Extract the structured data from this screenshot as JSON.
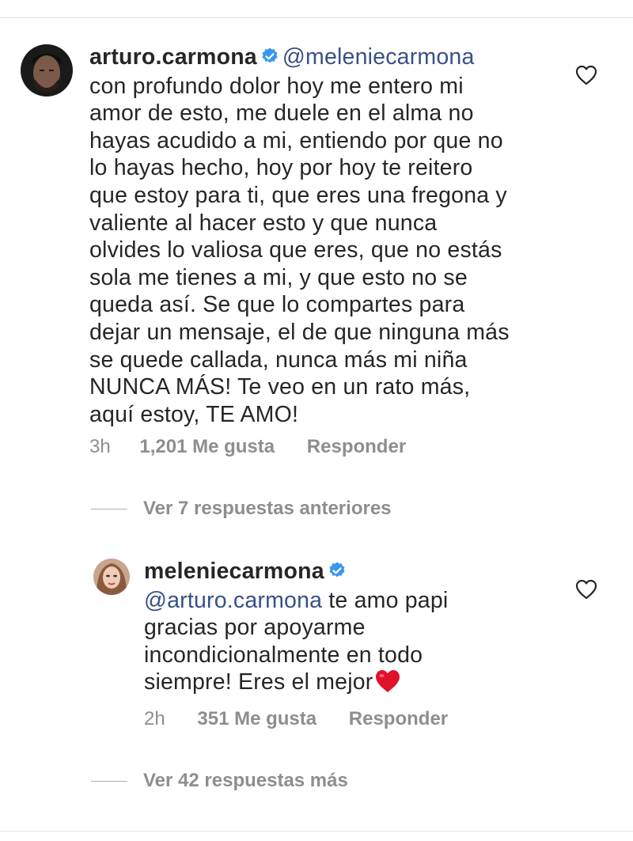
{
  "comments": {
    "main": {
      "username": "arturo.carmona",
      "mention": "@meleniecarmona",
      "lines": [
        "con profundo dolor hoy me entero mi",
        "amor de esto, me duele en el alma no",
        "hayas acudido a mi, entiendo por que no",
        "lo hayas hecho, hoy por hoy te reitero",
        "que estoy para ti, que eres una fregona y",
        "valiente al hacer esto y que nunca",
        "olvides lo valiosa que eres, que no estás",
        "sola me tienes a mi, y que esto no se",
        "queda así. Se que lo compartes para",
        "dejar un mensaje, el de que ninguna más",
        "se quede callada, nunca más mi niña",
        "NUNCA MÁS! Te veo en un rato más,",
        "aquí estoy, TE AMO!"
      ],
      "time": "3h",
      "likes": "1,201 Me gusta",
      "reply": "Responder"
    },
    "view_previous": "Ver 7 respuestas anteriores",
    "reply": {
      "username": "meleniecarmona",
      "mention": "@arturo.carmona",
      "first_line_rest": " te amo papi",
      "lines": [
        "gracias por apoyarme",
        "incondicionalmente en todo"
      ],
      "last_line": "siempre! Eres el mejor",
      "emoji": "red-heart-emoji",
      "time": "2h",
      "likes": "351 Me gusta",
      "reply": "Responder"
    },
    "view_more": "Ver 42 respuestas más"
  },
  "colors": {
    "text": "#262626",
    "meta": "#8e8e8e",
    "mention": "#385185",
    "verified": "#3897f0",
    "heart_emoji": "#e0112b"
  },
  "icons": [
    "verified-badge-icon",
    "like-heart-icon",
    "red-heart-emoji"
  ]
}
